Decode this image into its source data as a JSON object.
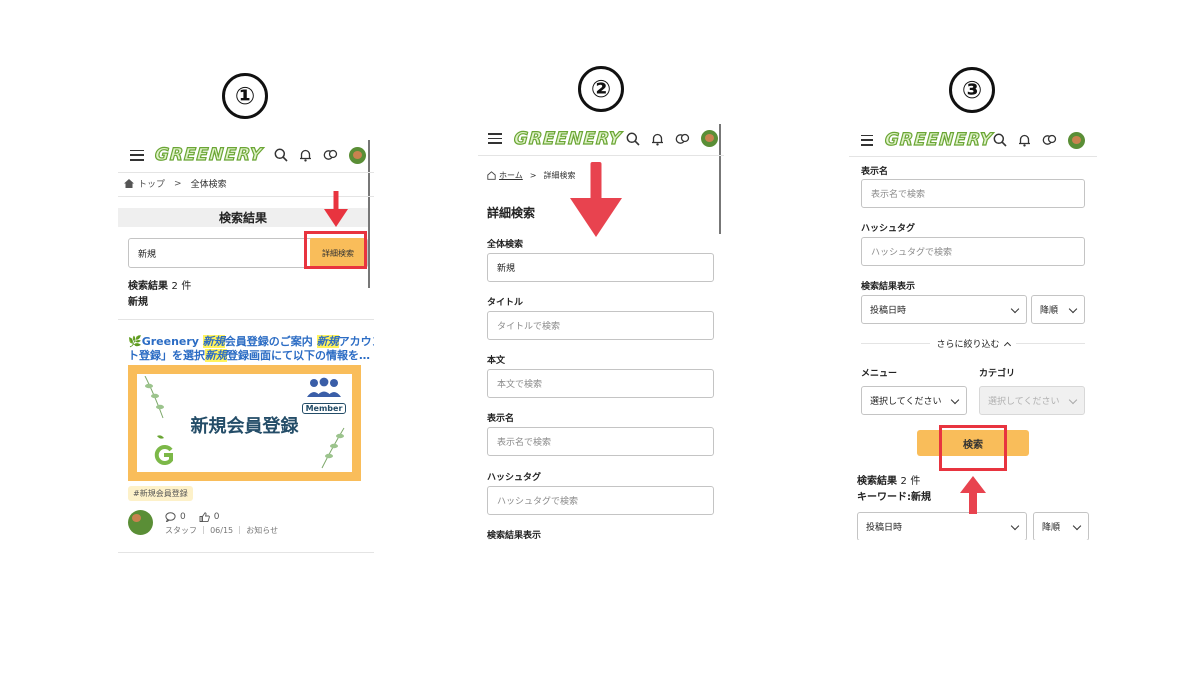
{
  "steps": [
    "①",
    "②",
    "③"
  ],
  "header": {
    "logo": "GREENERY"
  },
  "panel1": {
    "breadcrumb": {
      "home": "トップ",
      "sep": ">",
      "current": "全体検索"
    },
    "title": "検索結果",
    "search_value": "新規",
    "advanced_button": "詳細検索",
    "result_count_label": "検索結果",
    "result_count": "2",
    "result_unit": "件",
    "keyword": "新規",
    "article": {
      "title_parts": [
        "🌿Greenery ",
        "新規",
        "会員登録のご案内 ",
        "新規",
        "アカウン"
      ],
      "line2_parts": [
        "ト登録」を選択",
        "新規",
        "登録画面にて以下の情報を…"
      ],
      "banner_text": "新規会員登録",
      "member_label": "Member",
      "tag": "#新規会員登録",
      "comments": "0",
      "likes": "0",
      "meta": "スタッフ ｜ 06/15 ｜ お知らせ"
    }
  },
  "panel2": {
    "breadcrumb": {
      "home": "ホーム",
      "sep": ">",
      "current": "詳細検索"
    },
    "title": "詳細検索",
    "fields": [
      {
        "label": "全体検索",
        "value": "新規",
        "placeholder": ""
      },
      {
        "label": "タイトル",
        "value": "",
        "placeholder": "タイトルで検索"
      },
      {
        "label": "本文",
        "value": "",
        "placeholder": "本文で検索"
      },
      {
        "label": "表示名",
        "value": "",
        "placeholder": "表示名で検索"
      },
      {
        "label": "ハッシュタグ",
        "value": "",
        "placeholder": "ハッシュタグで検索"
      }
    ],
    "result_display_label": "検索結果表示"
  },
  "panel3": {
    "display_name_label": "表示名",
    "display_name_placeholder": "表示名で検索",
    "hashtag_label": "ハッシュタグ",
    "hashtag_placeholder": "ハッシュタグで検索",
    "result_display_label": "検索結果表示",
    "sort_field": "投稿日時",
    "sort_order": "降順",
    "narrow_down": "さらに絞り込む",
    "menu_label": "メニュー",
    "category_label": "カテゴリ",
    "menu_select": "選択してください",
    "category_select": "選択してください",
    "search_button": "検索",
    "result_count_label": "検索結果",
    "result_count": "2",
    "result_unit": "件",
    "keyword_line": "キーワード:新規",
    "sort_field_2": "投稿日時",
    "sort_order_2": "降順"
  },
  "colors": {
    "accent_orange": "#f9bd5a",
    "highlight_red": "#e8343f",
    "link_blue": "#2b6cc4",
    "logo_green": "#6aa534"
  }
}
